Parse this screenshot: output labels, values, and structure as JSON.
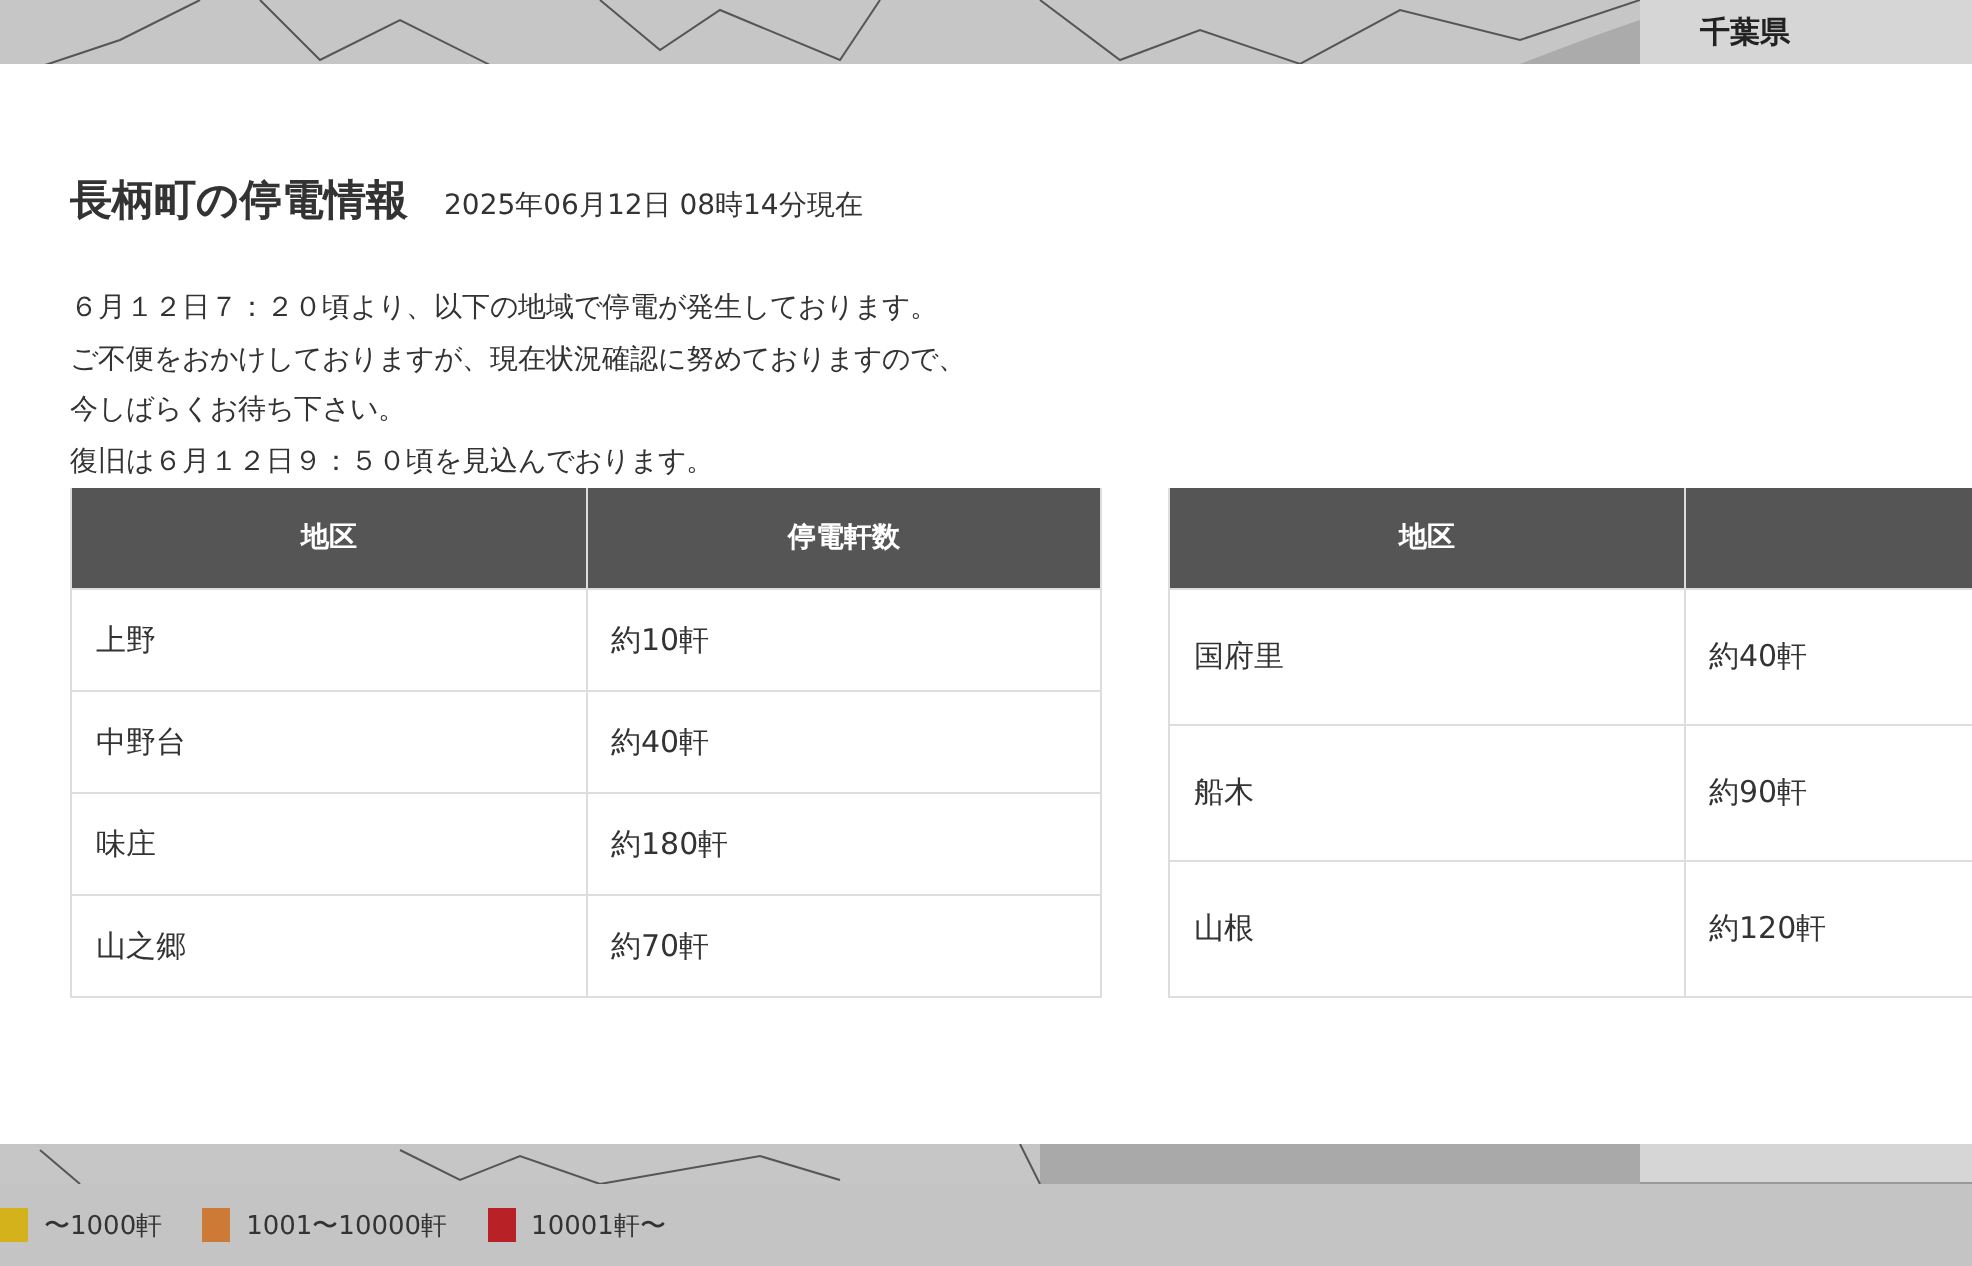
{
  "side_panel": {
    "title": "千葉県"
  },
  "modal": {
    "title": "長柄町の停電情報",
    "timestamp": "2025年06月12日 08時14分現在",
    "message": [
      "６月１２日７：２０頃より、以下の地域で停電が発生しております。",
      "ご不便をおかけしておりますが、現在状況確認に努めておりますので、",
      "今しばらくお待ち下さい。",
      "復旧は６月１２日９：５０頃を見込んでおります。"
    ],
    "tables": [
      {
        "columns": [
          "地区",
          "停電軒数"
        ],
        "rows": [
          [
            "上野",
            "約10軒"
          ],
          [
            "中野台",
            "約40軒"
          ],
          [
            "味庄",
            "約180軒"
          ],
          [
            "山之郷",
            "約70軒"
          ]
        ]
      },
      {
        "columns": [
          "地区"
        ],
        "rows": [
          [
            "国府里",
            "約40軒"
          ],
          [
            "船木",
            "約90軒"
          ],
          [
            "山根",
            "約120軒"
          ]
        ]
      }
    ]
  },
  "legend": [
    {
      "label": "〜1000軒",
      "color": "#d4b21c"
    },
    {
      "label": "1001〜10000軒",
      "color": "#cc7a35"
    },
    {
      "label": "10001軒〜",
      "color": "#b82226"
    }
  ]
}
